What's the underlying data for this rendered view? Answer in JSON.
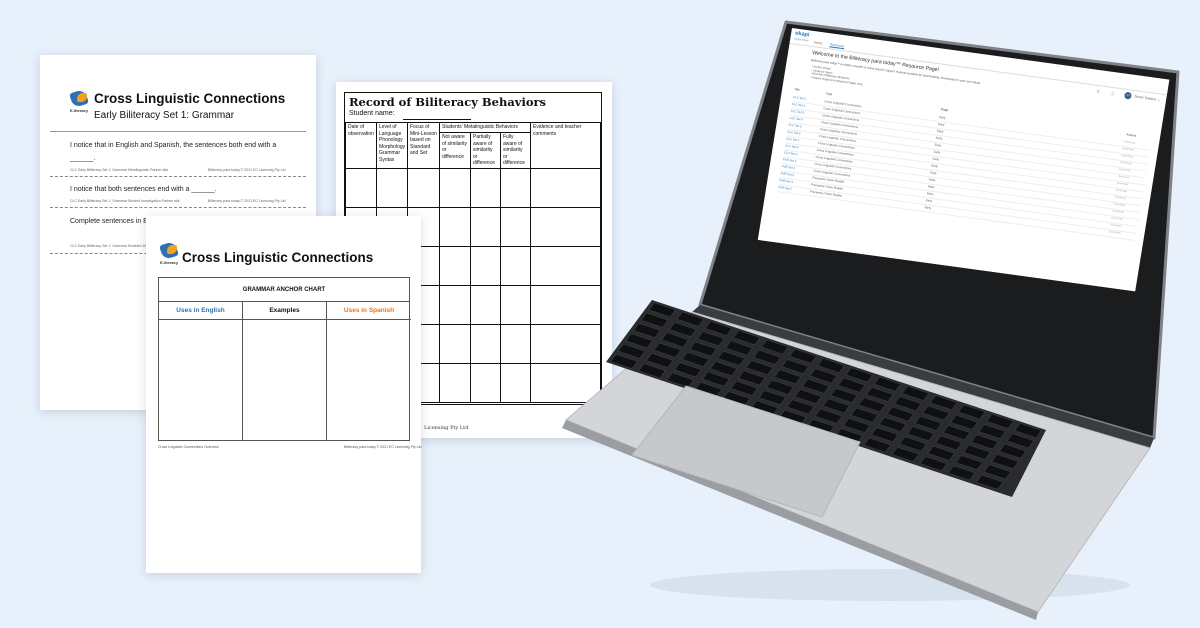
{
  "sheet1": {
    "logo_caption": "E-literacy",
    "title": "Cross Linguistic Connections",
    "subtitle": "Early Biliteracy Set 1: Grammar",
    "prompts": [
      {
        "text": "I notice that in English and Spanish, the sentences both end with a ______.",
        "footer_left": "CLC Early Biliteracy Set 1: Grammar Metalinguistic Partner talk",
        "footer_right": "Biliteracy para today © 2021 EC Licensing Pty Ltd"
      },
      {
        "text": "I notice that both sentences end with a ______.",
        "footer_left": "CLC Early Biliteracy Set 1: Grammar Student Investigation Partner talk",
        "footer_right": "Biliteracy para today © 2021 EC Licensing Pty Ltd"
      },
      {
        "text": "Complete sentences in E… For example, ______.",
        "footer_left": "CLC Early Biliteracy Set 1: Grammar Modeled Writing",
        "footer_right": ""
      }
    ]
  },
  "sheet2": {
    "title": "Record of Biliteracy Behaviors",
    "student_label": "Student name:",
    "columns": {
      "date": "Date of observation",
      "level": "Level of Language Phonology Morphology Grammar Syntax",
      "focus": "Focus of Mini-Lesson based on Standard and Set",
      "group": "Students’ Metalinguistic Behaviors",
      "not_aware": "Not aware of similarity or difference",
      "partially": "Partially aware of similarity or difference",
      "fully": "Fully aware of similarity or difference",
      "evidence": "Evidence and teacher comments"
    },
    "copyright": "Licensing Pty Ltd"
  },
  "sheet3": {
    "logo_caption": "E-literacy",
    "title": "Cross Linguistic Connections",
    "chart_title": "GRAMMAR ANCHOR CHART",
    "col_english": "Uses in English",
    "col_examples": "Examples",
    "col_spanish": "Uses in Spanish",
    "footer_left": "Cross Linguistic Connections Overview",
    "footer_right": "Biliteracy para today © 2021 EC Licensing Pty Ltd",
    "colors": {
      "english": "#2f6fb5",
      "spanish": "#e8731f"
    }
  },
  "laptop_app": {
    "brand": "okapi",
    "brand_sub": "digital library",
    "tabs": [
      "Books",
      "Resources"
    ],
    "user_initials": "DT",
    "user_name": "Demo Teacher",
    "welcome": "Welcome to the Biliteracy para today™ Resource Page!",
    "intro": "Biliteracy para today™ provides a wealth of online teacher support material available for downloading. Downloads for each set include:",
    "bullets": [
      "Anchor Charts",
      "Sentence Stems",
      "Records of Biliteracy Behaviors",
      "Graphic Organizers (Advanced Stage only)"
    ],
    "table": {
      "headers": [
        "Title",
        "Type",
        "Stage",
        "Actions"
      ],
      "rows": [
        {
          "title": "CLC Set 1",
          "type": "Cross Linguistic Connections",
          "stage": "Early",
          "action": "Download"
        },
        {
          "title": "CLC Set 2",
          "type": "Cross Linguistic Connections",
          "stage": "Early",
          "action": "Download"
        },
        {
          "title": "CLC Set 3",
          "type": "Cross Linguistic Connections",
          "stage": "Early",
          "action": "Download"
        },
        {
          "title": "CLC Set 4",
          "type": "Cross Linguistic Connections",
          "stage": "Early",
          "action": "Download"
        },
        {
          "title": "CLC Set 5",
          "type": "Cross Linguistic Connections",
          "stage": "Early",
          "action": "Download"
        },
        {
          "title": "CLC Set 6",
          "type": "Cross Linguistic Connections",
          "stage": "Early",
          "action": "Download"
        },
        {
          "title": "CLC Set 7",
          "type": "Cross Linguistic Connections",
          "stage": "Early",
          "action": "Download"
        },
        {
          "title": "CLC Set 8",
          "type": "Cross Linguistic Connections",
          "stage": "Early",
          "action": "Download"
        },
        {
          "title": "CLC Set 9",
          "type": "Cross Linguistic Connections",
          "stage": "Early",
          "action": "Download"
        },
        {
          "title": "PVR Set 1",
          "type": "Cross Linguistic Connections",
          "stage": "Early",
          "action": "Download"
        },
        {
          "title": "PVR Set 2",
          "type": "Cross Linguistic Connections",
          "stage": "Early",
          "action": "Download"
        },
        {
          "title": "PVR Set 3",
          "type": "Preceptive Vision Reader",
          "stage": "Early",
          "action": "Download"
        },
        {
          "title": "PVR Set 4",
          "type": "Preceptive Vision Reader",
          "stage": "Early",
          "action": "Download"
        },
        {
          "title": "PVR Set 5",
          "type": "Preceptive Vision Reader",
          "stage": "Early",
          "action": "Download"
        }
      ]
    }
  }
}
